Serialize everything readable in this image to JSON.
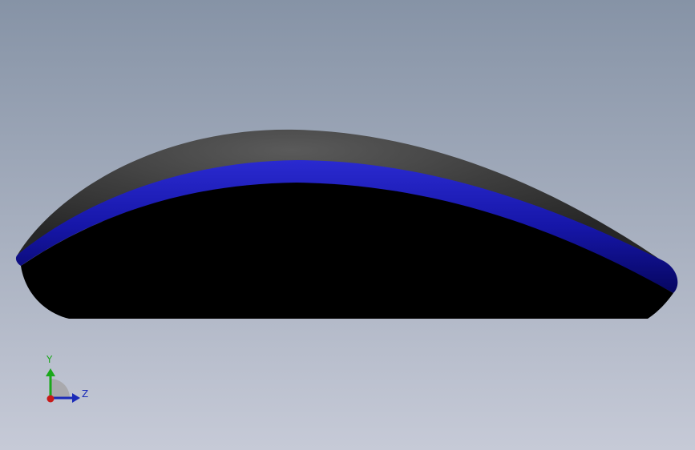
{
  "viewport": {
    "background_top": "#8693a6",
    "background_bottom": "#c6cad7"
  },
  "model": {
    "shell_color": "#3a3a3a",
    "band_color": "#1c1cb4",
    "body_color": "#000000"
  },
  "triad": {
    "y_label": "Y",
    "z_label": "Z",
    "y_color": "#1aa81a",
    "z_color": "#1a2ab8",
    "x_color": "#c81a1a"
  }
}
